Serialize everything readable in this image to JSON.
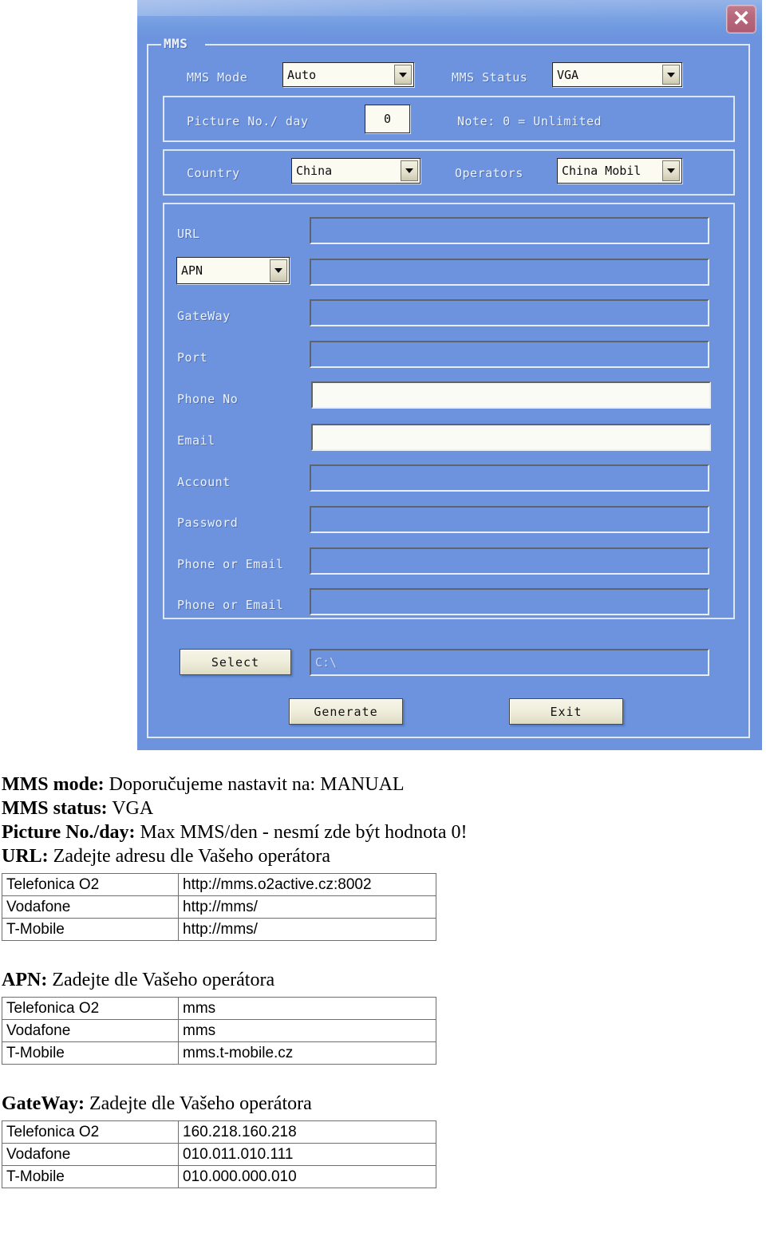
{
  "window": {
    "close_label": "✕",
    "group_legend": "MMS"
  },
  "form": {
    "mms_mode_label": "MMS Mode",
    "mms_mode_value": "Auto",
    "mms_status_label": "MMS Status",
    "mms_status_value": "VGA",
    "picture_no_label": "Picture No./ day",
    "picture_no_value": "0",
    "note_label": "Note: 0 = Unlimited",
    "country_label": "Country",
    "country_value": "China",
    "operators_label": "Operators",
    "operators_value": "China Mobil",
    "url_label": "URL",
    "url_value": "",
    "apn_value": "APN",
    "apn_field_value": "",
    "gateway_label": "GateWay",
    "gateway_value": "",
    "port_label": "Port",
    "port_value": "",
    "phone_no_label": "Phone No",
    "phone_no_value": "",
    "email_label": "Email",
    "email_value": "",
    "account_label": "Account",
    "account_value": "",
    "password_label": "Password",
    "password_value": "",
    "phone_or_email_1_label": "Phone or Email",
    "phone_or_email_1_value": "",
    "phone_or_email_2_label": "Phone or Email",
    "phone_or_email_2_value": "",
    "select_button": "Select",
    "path_value": "C:\\",
    "generate_button": "Generate",
    "exit_button": "Exit"
  },
  "doc": {
    "lines": [
      {
        "bold": "MMS mode:",
        "rest": " Doporučujeme nastavit na: MANUAL"
      },
      {
        "bold": "MMS status:",
        "rest": " VGA"
      },
      {
        "bold": "Picture No./day:",
        "rest": " Max MMS/den - nesmí zde být hodnota 0!"
      },
      {
        "bold": "URL:",
        "rest": " Zadejte adresu dle Vašeho operátora"
      }
    ],
    "url_table": {
      "rows": [
        {
          "operator": "Telefonica O2",
          "value": "http://mms.o2active.cz:8002"
        },
        {
          "operator": "Vodafone",
          "value": "http://mms/"
        },
        {
          "operator": "T-Mobile",
          "value": "http://mms/"
        }
      ]
    },
    "apn_head": {
      "bold": "APN:",
      "rest": " Zadejte dle Vašeho operátora"
    },
    "apn_table": {
      "rows": [
        {
          "operator": "Telefonica O2",
          "value": "mms"
        },
        {
          "operator": "Vodafone",
          "value": "mms"
        },
        {
          "operator": "T-Mobile",
          "value": "mms.t-mobile.cz"
        }
      ]
    },
    "gateway_head": {
      "bold": "GateWay:",
      "rest": " Zadejte dle Vašeho operátora"
    },
    "gateway_table": {
      "rows": [
        {
          "operator": "Telefonica O2",
          "value": "160.218.160.218"
        },
        {
          "operator": "Vodafone",
          "value": "010.011.010.111"
        },
        {
          "operator": "T-Mobile",
          "value": "010.000.000.010"
        }
      ]
    }
  },
  "colors": {
    "dialog_blue": "#6d93de",
    "title_light": "#95b3e8",
    "close_red": "#b9697e",
    "button_face": "#eeecd9",
    "field_white": "#fbfbf5",
    "border_light": "#dfe8f8"
  }
}
